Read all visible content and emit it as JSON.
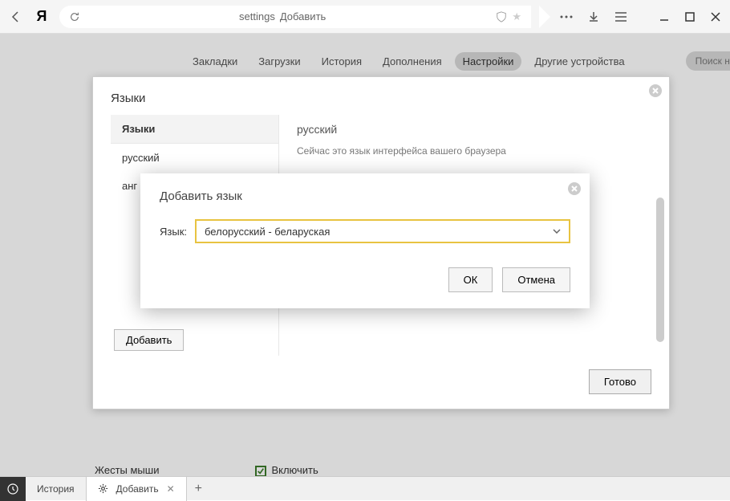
{
  "titlebar": {
    "url_prefix": "settings",
    "url_page": "Добавить"
  },
  "tabs": {
    "bookmarks": "Закладки",
    "downloads": "Загрузки",
    "history": "История",
    "addons": "Дополнения",
    "settings": "Настройки",
    "other_devices": "Другие устройства",
    "search_placeholder": "Поиск наст"
  },
  "lang_dialog": {
    "title": "Языки",
    "sidebar_header": "Языки",
    "items": [
      "русский",
      "анг"
    ],
    "current": "русский",
    "desc": "Сейчас это язык интерфейса вашего браузера",
    "add": "Добавить",
    "done": "Готово"
  },
  "add_modal": {
    "title": "Добавить язык",
    "label": "Язык:",
    "selected": "белорусский - беларуская",
    "ok": "ОК",
    "cancel": "Отмена"
  },
  "gestures": {
    "label": "Жесты мыши",
    "enable": "Включить"
  },
  "bottombar": {
    "history": "История",
    "active_tab": "Добавить"
  }
}
